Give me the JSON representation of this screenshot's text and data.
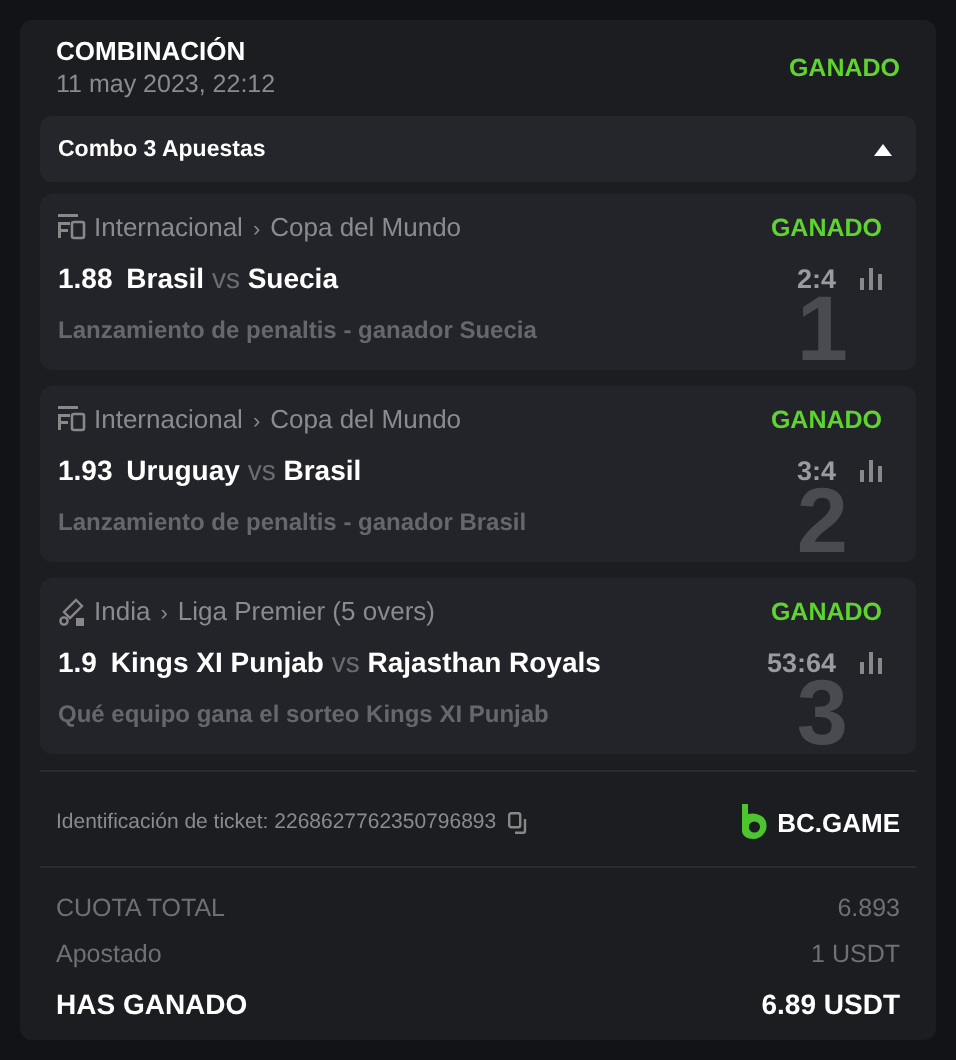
{
  "header": {
    "title": "COMBINACIÓN",
    "date": "11 may 2023, 22:12",
    "status": "GANADO"
  },
  "combo": {
    "label": "Combo 3 Apuestas",
    "expanded": true
  },
  "bets": [
    {
      "kind": "fifa",
      "country": "Internacional",
      "separator": "›",
      "league": "Copa del Mundo",
      "status": "GANADO",
      "odds": "1.88",
      "home": "Brasil",
      "vs": "vs",
      "away": "Suecia",
      "score": "2:4",
      "market": "Lanzamiento de penaltis - ganador Suecia",
      "index": "1"
    },
    {
      "kind": "fifa",
      "country": "Internacional",
      "separator": "›",
      "league": "Copa del Mundo",
      "status": "GANADO",
      "odds": "1.93",
      "home": "Uruguay",
      "vs": "vs",
      "away": "Brasil",
      "score": "3:4",
      "market": "Lanzamiento de penaltis - ganador Brasil",
      "index": "2"
    },
    {
      "kind": "cricket",
      "country": "India",
      "separator": "›",
      "league": "Liga Premier (5 overs)",
      "status": "GANADO",
      "odds": "1.9",
      "home": "Kings XI Punjab",
      "vs": "vs",
      "away": "Rajasthan Royals",
      "score": "53:64",
      "market": "Qué equipo gana el sorteo Kings XI Punjab",
      "index": "3"
    }
  ],
  "ticket": {
    "label": "Identificación de ticket: 2268627762350796893",
    "brand": "BC.GAME"
  },
  "totals": [
    {
      "kind": "muted",
      "label": "CUOTA TOTAL",
      "value": "6.893"
    },
    {
      "kind": "muted",
      "label": "Apostado",
      "value": "1 USDT"
    },
    {
      "kind": "strong",
      "label": "HAS GANADO",
      "value": "6.89 USDT"
    }
  ]
}
